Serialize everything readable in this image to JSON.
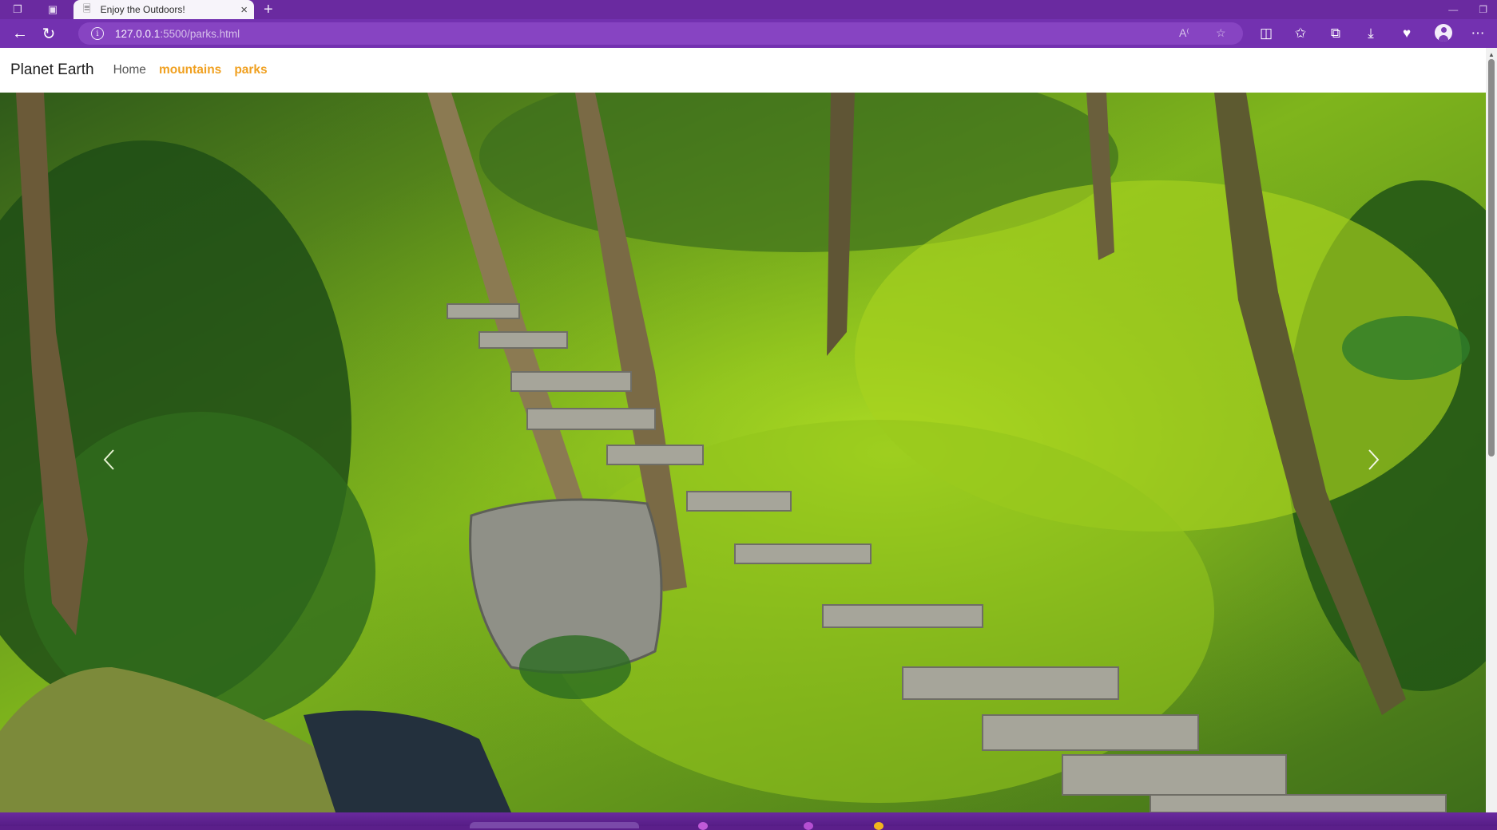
{
  "browser": {
    "tab_title": "Enjoy the Outdoors!",
    "url_host": "127.0.0.1",
    "url_rest": ":5500/parks.html",
    "accent": "#7331b0"
  },
  "navbar": {
    "brand": "Planet Earth",
    "links": [
      {
        "label": "Home",
        "active": false
      },
      {
        "label": "mountains",
        "active": true
      },
      {
        "label": "parks",
        "active": true
      }
    ],
    "active_color": "#f0a020"
  },
  "carousel": {
    "slide_description": "forest park with stone stairs, moss and trees",
    "prev_icon": "chevron-left-icon",
    "next_icon": "chevron-right-icon"
  }
}
